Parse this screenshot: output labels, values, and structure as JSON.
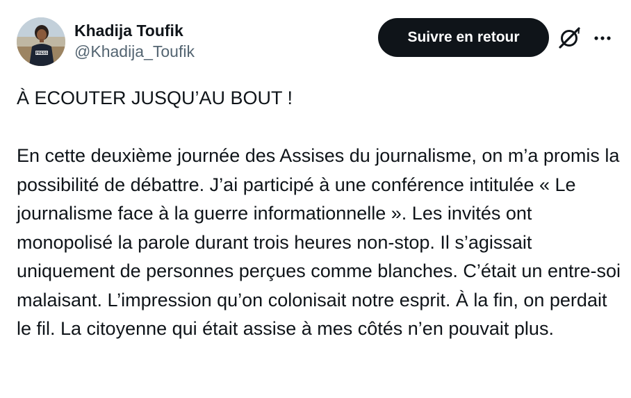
{
  "author": {
    "display_name": "Khadija Toufik",
    "handle": "@Khadija_Toufik",
    "avatar_badge": "PRESS"
  },
  "actions": {
    "follow_label": "Suivre en retour",
    "grok_icon": "grok-icon",
    "more_icon": "more-dots-icon"
  },
  "tweet": {
    "text": "À ECOUTER JUSQU’AU BOUT !\n\nEn cette deuxième journée des Assises du journalisme, on m’a promis la possibilité de débattre. J’ai participé à une conférence intitulée « Le journalisme face à la guerre informationnelle ». Les invités ont monopolisé la parole durant trois heures non-stop. Il s’agissait uniquement de personnes perçues comme blanches. C’était un entre-soi malaisant. L’impression qu’on colonisait notre esprit. À la fin, on perdait le fil. La citoyenne qui était assise à mes côtés n’en pouvait plus."
  },
  "colors": {
    "text_primary": "#0f1419",
    "text_secondary": "#536471",
    "button_bg": "#0f1419",
    "button_text": "#ffffff"
  }
}
